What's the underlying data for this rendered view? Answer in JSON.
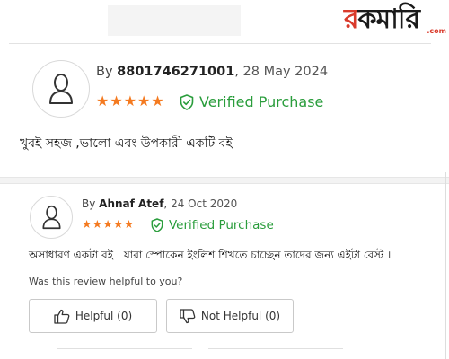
{
  "brand": {
    "logo_part1": "র",
    "logo_part2": "ক",
    "logo_part3": "মা",
    "logo_part4": "রি",
    "logo_suffix": ".com",
    "accent_color": "#d93a2b"
  },
  "reviews": [
    {
      "by_prefix": "By ",
      "reviewer": "8801746271001",
      "separator": ", ",
      "date": "28 May 2024",
      "rating": 5,
      "verified_label": "Verified Purchase",
      "text": "খুবই সহজ ,ভালো এবং উপকারী একটি বই",
      "avatar_icon": "user-outline-icon"
    },
    {
      "by_prefix": "By ",
      "reviewer": "Ahnaf Atef",
      "separator": ", ",
      "date": "24 Oct 2020",
      "rating": 5,
      "verified_label": "Verified Purchase",
      "text": "অসাধারণ একটা বই । যারা স্পোকেন ইংলিশ শিখতে চাচ্ছেন তাদের জন্য এইটা বেস্ট ।",
      "avatar_icon": "user-outline-icon"
    }
  ],
  "feedback": {
    "question": "Was this review helpful to you?",
    "helpful_label": "Helpful (0)",
    "not_helpful_label": "Not Helpful (0)"
  },
  "colors": {
    "star": "#f47a20",
    "verified": "#2a9d3c"
  }
}
